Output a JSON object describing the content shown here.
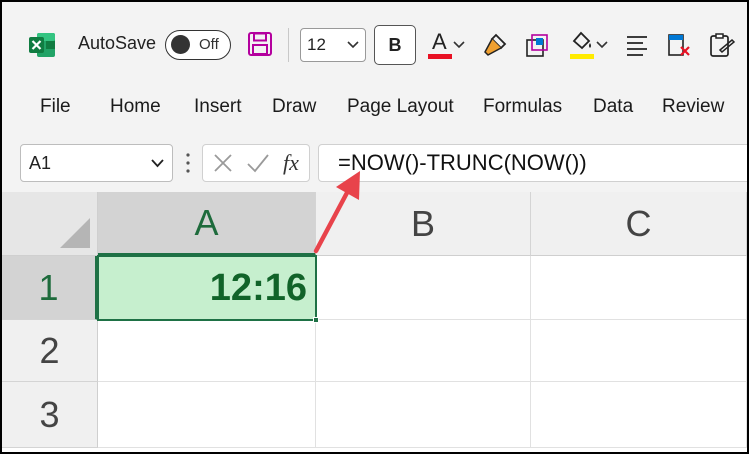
{
  "toolbar": {
    "autosave_label": "AutoSave",
    "autosave_state": "Off",
    "font_size": "12",
    "bold_label": "B",
    "font_color_letter": "A",
    "font_color": "#e81123",
    "fill_color": "#ffeb00",
    "accent": "#1e7145",
    "icons": [
      "excel-logo-icon",
      "save-icon",
      "font-color-icon",
      "format-painter-icon",
      "cell-styles-icon",
      "fill-color-icon",
      "align-icon",
      "clear-format-icon",
      "paste-special-icon"
    ]
  },
  "menu": {
    "tabs": [
      {
        "label": "File"
      },
      {
        "label": "Home"
      },
      {
        "label": "Insert"
      },
      {
        "label": "Draw"
      },
      {
        "label": "Page Layout"
      },
      {
        "label": "Formulas"
      },
      {
        "label": "Data"
      },
      {
        "label": "Review"
      }
    ]
  },
  "formula_bar": {
    "name_box": "A1",
    "fx_label": "fx",
    "formula": "=NOW()-TRUNC(NOW())"
  },
  "grid": {
    "columns": [
      "A",
      "B",
      "C"
    ],
    "rows": [
      "1",
      "2",
      "3"
    ],
    "active_cell": "A1",
    "a1_value": "12:16",
    "a1_fill": "#c6efce",
    "a1_text_color": "#116329"
  },
  "annotation": {
    "arrow_color": "#e8434b"
  }
}
